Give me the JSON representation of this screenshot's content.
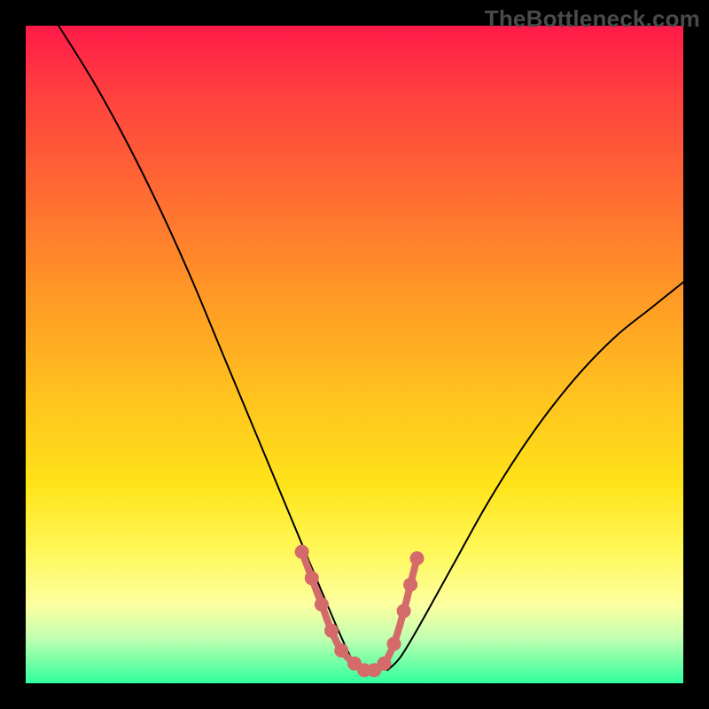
{
  "watermark": "TheBottleneck.com",
  "colors": {
    "background": "#000000",
    "gradient_top": "#ff1a49",
    "gradient_bottom": "#2fff9e",
    "curve": "#000000",
    "beads": "#d46a6a"
  },
  "chart_data": {
    "type": "line",
    "title": "",
    "xlabel": "",
    "ylabel": "",
    "xlim": [
      0,
      100
    ],
    "ylim": [
      0,
      100
    ],
    "grid": false,
    "legend": false,
    "notes": "V-shaped bottleneck curve on rainbow gradient; no axes or tick labels visible. Values below are approximate readings of the drawn curve in percent of plot area (x left→right, y bottom→top). Pink bead segment near the valley is the highlighted 'sweet spot' region.",
    "series": [
      {
        "name": "curve-left",
        "x": [
          5,
          10,
          15,
          20,
          25,
          30,
          35,
          40,
          45,
          48,
          50,
          51.5
        ],
        "y": [
          100,
          92,
          83,
          73,
          62,
          50,
          38,
          26,
          14,
          7,
          3,
          2
        ]
      },
      {
        "name": "curve-right",
        "x": [
          55,
          57,
          60,
          65,
          70,
          75,
          80,
          85,
          90,
          95,
          100
        ],
        "y": [
          2,
          4,
          9,
          18,
          27,
          35,
          42,
          48,
          53,
          57,
          61
        ]
      },
      {
        "name": "highlight-beads",
        "x": [
          42,
          43.5,
          45,
          46.5,
          48,
          50,
          51.5,
          53,
          54.5,
          56,
          57.5,
          58.5,
          59.5
        ],
        "y": [
          20,
          16,
          12,
          8,
          5,
          3,
          2,
          2,
          3,
          6,
          11,
          15,
          19
        ]
      }
    ]
  }
}
